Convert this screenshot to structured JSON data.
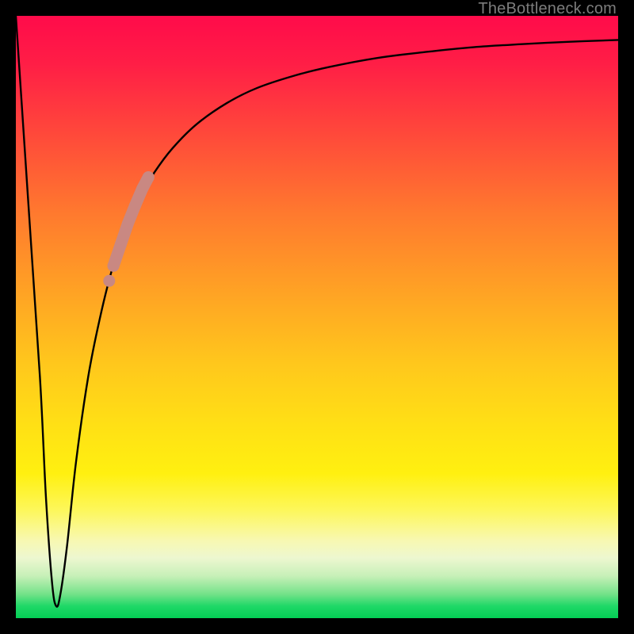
{
  "watermark": "TheBottleneck.com",
  "colors": {
    "frame": "#000000",
    "curve": "#000000",
    "highlight": "#c98882",
    "gradient_top": "#ff0b4a",
    "gradient_bottom": "#04cf55"
  },
  "chart_data": {
    "type": "line",
    "title": "",
    "xlabel": "",
    "ylabel": "",
    "xlim": [
      0,
      100
    ],
    "ylim": [
      0,
      100
    ],
    "note": "Bottleneck-percentage style curve. The vertical background gradient encodes severity (red=high, green=low). The black curve shows bottleneck % vs. a swept parameter. No axis ticks or numeric labels are rendered in the source image, so all values below are geometric estimates read from the plot in 0–100 normalized units.",
    "series": [
      {
        "name": "bottleneck-curve",
        "x": [
          0,
          2,
          4,
          5,
          6,
          6.7,
          7.4,
          8.5,
          10,
          12,
          14,
          16,
          18,
          20,
          23,
          26,
          30,
          35,
          40,
          46,
          52,
          60,
          68,
          76,
          84,
          92,
          100
        ],
        "y": [
          100,
          70,
          40,
          20,
          6,
          2,
          4,
          12,
          26,
          40,
          50,
          58,
          64,
          69,
          74,
          78,
          82,
          85.5,
          88,
          90,
          91.5,
          93,
          94,
          94.8,
          95.3,
          95.7,
          96
        ]
      }
    ],
    "highlight_segment": {
      "name": "highlighted-range",
      "description": "Thick salmon overlay on the ascending limb of the curve.",
      "points": [
        {
          "x": 15.5,
          "y": 56
        },
        {
          "x": 16.2,
          "y": 58.5
        },
        {
          "x": 17.4,
          "y": 62
        },
        {
          "x": 18.6,
          "y": 65.5
        },
        {
          "x": 19.8,
          "y": 68.5
        },
        {
          "x": 21.0,
          "y": 71.3
        },
        {
          "x": 22.0,
          "y": 73.2
        }
      ],
      "gap_between_indices": [
        0,
        1
      ]
    }
  }
}
